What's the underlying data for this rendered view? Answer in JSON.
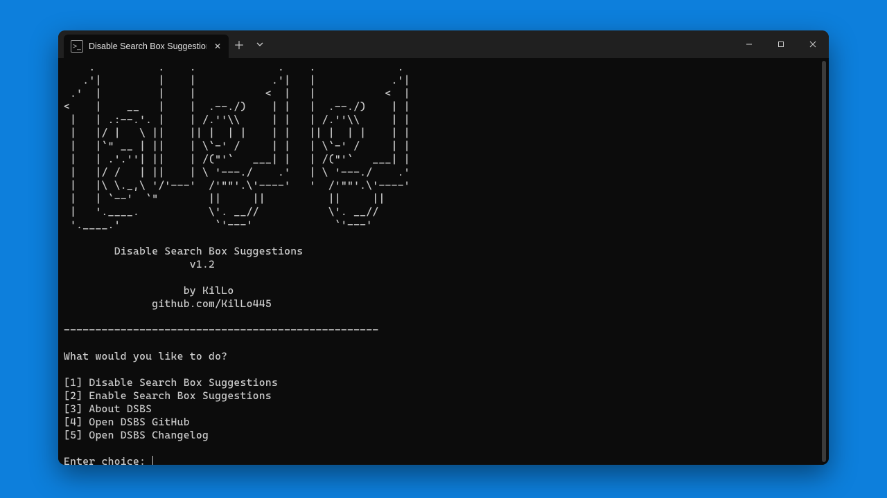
{
  "window": {
    "tab_title": "Disable Search Box Suggestion",
    "tab_icon_glyph": "❯_"
  },
  "ascii_art": "    .          .    .             .    .             .    \n   .'|         |    |            .'|   |            .'|   \n .'  |         |    |           <  |   |           <  |   \n<    |    __   |    |  .--./)    | |   |  .--./)    | |   \n |   | .:--.'. |    | /.''\\\\     | |   | /.''\\\\     | |   \n |   |/ |   \\ ||    || |  | |    | |   || |  | |    | |   \n |   |`\" __ | ||    | \\`-' /     | |   | \\`-' /     | |   \n |   | .'.''| ||    | /(\"'`   ___| |   | /(\"'`   ___| |   \n |   |/ /   | ||    | \\ '---./    .'   | \\ '---./    .'   \n |   |\\ \\._,\\ '/'---'  /'\"\"'.\\'----'   '  /'\"\"'.\\'----'   \n |   | `--'  `\"        ||     ||          ||     ||       \n |   '.____.           \\'. __//           \\'. __//        \n '.____.'               `'---'             `'---'        ",
  "header": {
    "title_line": "        Disable Search Box Suggestions",
    "version_line": "                    v1.2",
    "author_line": "                   by KilLo",
    "repo_line": "              github.com/KilLo445"
  },
  "divider": "--------------------------------------------------",
  "prompt_question": "What would you like to do?",
  "menu": [
    "[1] Disable Search Box Suggestions",
    "[2] Enable Search Box Suggestions",
    "[3] About DSBS",
    "[4] Open DSBS GitHub",
    "[5] Open DSBS Changelog"
  ],
  "input_prompt": "Enter choice: "
}
